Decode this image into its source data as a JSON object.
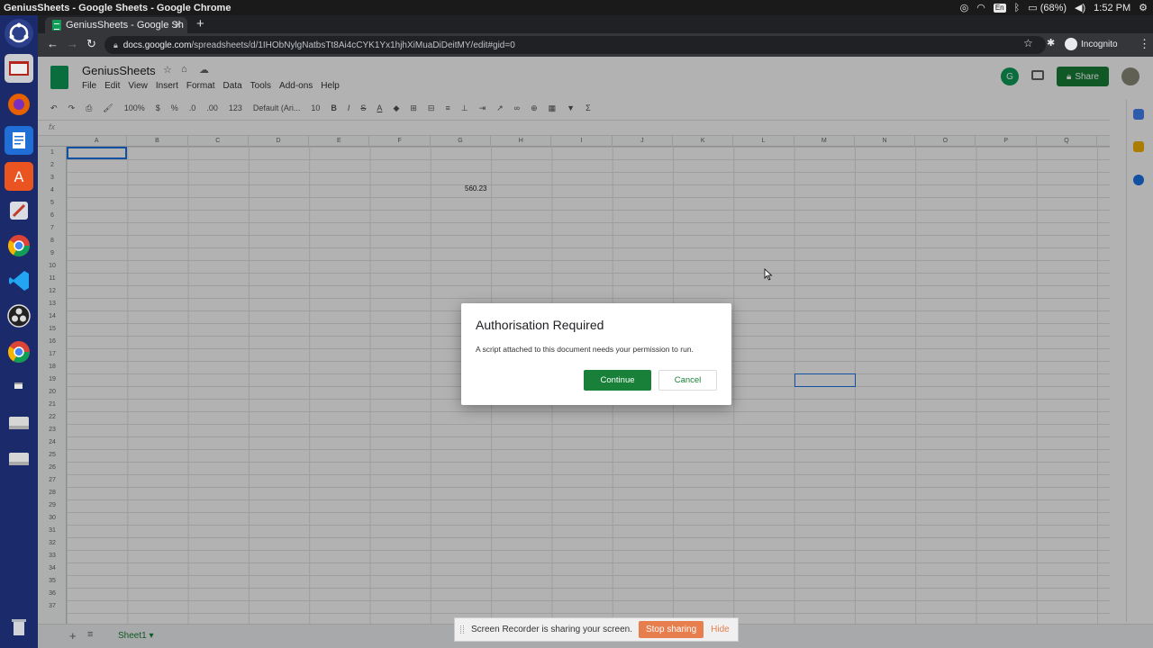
{
  "os_bar": {
    "window_title": "GeniusSheets - Google Sheets - Google Chrome",
    "keyboard": "En",
    "battery": "(68%)",
    "time": "1:52 PM"
  },
  "browser": {
    "tab_title": "GeniusSheets - Google Sh",
    "url_host": "docs.google.com",
    "url_path": "/spreadsheets/d/1IHObNylgNatbsTt8Ai4cCYK1Yx1hjhXiMuaDiDeitMY/edit#gid=0",
    "profile_label": "Incognito"
  },
  "sheets": {
    "doc_title": "GeniusSheets",
    "menus": [
      "File",
      "Edit",
      "View",
      "Insert",
      "Format",
      "Data",
      "Tools",
      "Add-ons",
      "Help"
    ],
    "share_label": "Share",
    "avatar_letter": "G",
    "zoom": "100%",
    "currency": "$",
    "percent": "%",
    "dec_less": ".0",
    "dec_more": ".00",
    "number_format": "123",
    "font": "Default (Ari...",
    "font_size": "10",
    "fx_label": "fx",
    "columns": [
      "A",
      "B",
      "C",
      "D",
      "E",
      "F",
      "G",
      "H",
      "I",
      "J",
      "K",
      "L",
      "M",
      "N",
      "O",
      "P",
      "Q"
    ],
    "rows": [
      "1",
      "2",
      "3",
      "4",
      "5",
      "6",
      "7",
      "8",
      "9",
      "10",
      "11",
      "12",
      "13",
      "14",
      "15",
      "16",
      "17",
      "18",
      "19",
      "20",
      "21",
      "22",
      "23",
      "24",
      "25",
      "26",
      "27",
      "28",
      "29",
      "30",
      "31",
      "32",
      "33",
      "34",
      "35",
      "36",
      "37"
    ],
    "cell_g4": "560.23",
    "sheet_tab": "Sheet1"
  },
  "dialog": {
    "title": "Authorisation Required",
    "body": "A script attached to this document needs your permission to run.",
    "continue_label": "Continue",
    "cancel_label": "Cancel"
  },
  "recorder": {
    "message": "Screen Recorder is sharing your screen.",
    "stop_label": "Stop sharing",
    "hide_label": "Hide"
  },
  "colors": {
    "sheets_green": "#188038",
    "launcher_bg": "#1b2a6b",
    "recorder_accent": "#e67e4d"
  }
}
